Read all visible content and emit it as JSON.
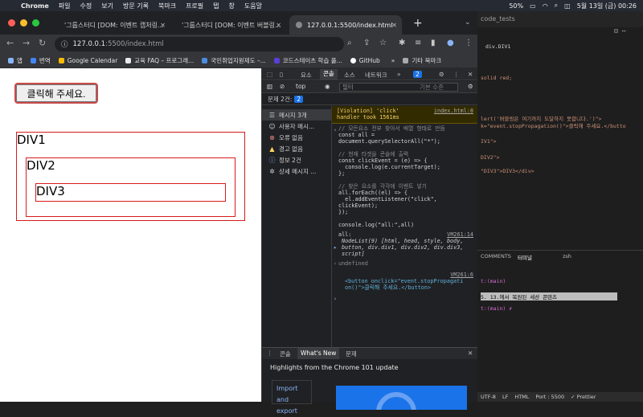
{
  "menubar": {
    "app": "Chrome",
    "items": [
      "파일",
      "수정",
      "보기",
      "방문 기록",
      "북마크",
      "프로필",
      "탭",
      "창",
      "도움말"
    ],
    "battery": "50%",
    "datetime": "5월 13일 (금) 00:26"
  },
  "browser": {
    "tabs": [
      {
        "title": "'그룹스터디 [DOM: 이벤트 캡처링..."
      },
      {
        "title": "'그룹스터디 [DOM: 이벤트 버블링..."
      },
      {
        "title": "127.0.0.1:5500/index.html"
      }
    ],
    "url_host": "127.0.0.1",
    "url_path": ":5500/index.html",
    "bookmarks": [
      "앱",
      "번역",
      "Google Calendar",
      "교육 FAQ – 프로그래...",
      "국민취업지원제도 –...",
      "코드스테이츠 학습 플...",
      "GitHub",
      "»",
      "기타 북마크"
    ]
  },
  "page": {
    "button_label": "클릭해 주세요.",
    "div1": "DIV1",
    "div2": "DIV2",
    "div3": "DIV3"
  },
  "devtools": {
    "tabs": [
      "요소",
      "콘솔",
      "소스",
      "네트워크",
      "»"
    ],
    "active_tab": "콘솔",
    "badge": "2",
    "context": "top",
    "filter_placeholder": "필터",
    "levels": "기본 수준",
    "issues_label": "문제 2건:",
    "issues_count": "2",
    "sidebar": [
      {
        "label": "메시지 3개",
        "icon": "list-icon"
      },
      {
        "label": "사용자 메시...",
        "icon": "user-icon"
      },
      {
        "label": "오류 없음",
        "icon": "error-icon"
      },
      {
        "label": "경고 없음",
        "icon": "warning-icon"
      },
      {
        "label": "정보 2건",
        "icon": "info-icon"
      },
      {
        "label": "상세 메시지 ...",
        "icon": "bug-icon"
      }
    ],
    "violation_line1": "[Violation] 'click'",
    "violation_line2": "handler took 1561ms",
    "violation_link": "index.html:8",
    "code": {
      "c1": "// 모든요소 전부 찾아서 배열 형태로 만듬",
      "c2a": "const all =",
      "c2b": "document.querySelectorAll(\"*\");",
      "c3": "// 현재 타겟을 콘솔에 출력",
      "c4a": "const clickEvent = (e) => {",
      "c4b": "  console.log(e.currentTarget);",
      "c4c": "};",
      "c5": "// 찾은 요소를 각각에 이벤트 넣기",
      "c6a": "all.forEach((el) => {",
      "c6b": "  el.addEventListener(\"click\",",
      "c6c": "clickEvent);",
      "c6d": "});",
      "c7": "console.log(\"all:\",all)"
    },
    "out_all_label": "all:",
    "out_vm1": "VM261:14",
    "out_nodelist1": "NodeList(9) [html, head, style, body,",
    "out_nodelist2": "button, div.div1, div.div2, div.div3,",
    "out_nodelist3": "script]",
    "out_undefined": "undefined",
    "out_vm2": "VM261:6",
    "out_button1": "<button onclick=\"event.stopPropagati",
    "out_button2": "on()\">클릭해 주세요.</button>",
    "drawer_tabs": [
      "콘솔",
      "What's New",
      "문제"
    ],
    "drawer_active": "What's New",
    "drawer_headline": "Highlights from the Chrome 101 update",
    "drawer_card": "Import and export"
  },
  "vscode": {
    "title": "code_tests",
    "breadcrumb": "div.DIV1",
    "lines": [
      "solid red;",
      "lert('버블링은 여기까지 도달하지 못합니다.')\">",
      "k=\"event.stopPropagation()\">클릭해 주세요.</butto",
      "IV1\">",
      "DIV2\">",
      "\"DIV3\">DIV3</div>"
    ],
    "panel_tabs": [
      "COMMENTS",
      "터미널",
      "zsh"
    ],
    "term1": "t:(main)",
    "term2": "5. 13.에서 복원된 세션 콘텐츠",
    "term3": "t:(main) ✗",
    "status": [
      "UTF-8",
      "LF",
      "HTML",
      "Port : 5500",
      "✓ Prettier"
    ]
  }
}
